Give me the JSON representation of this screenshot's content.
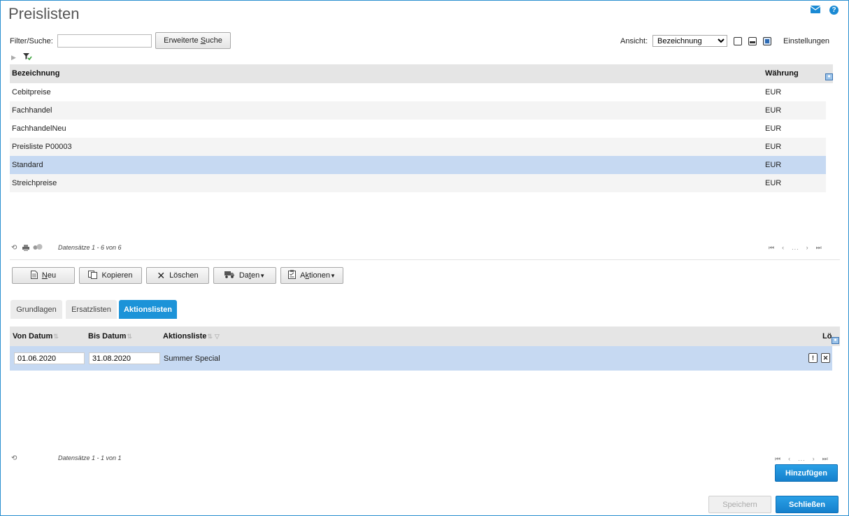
{
  "page": {
    "title": "Preislisten"
  },
  "filter": {
    "label": "Filter/Suche:",
    "value": "",
    "advanced_pre": "Erweiterte ",
    "advanced_u": "S",
    "advanced_post": "uche"
  },
  "view": {
    "label": "Ansicht:",
    "selected": "Bezeichnung",
    "settings": "Einstellungen"
  },
  "grid": {
    "headers": {
      "name": "Bezeichnung",
      "currency": "Währung"
    },
    "rows": [
      {
        "name": "Cebitpreise",
        "currency": "EUR"
      },
      {
        "name": "Fachhandel",
        "currency": "EUR"
      },
      {
        "name": "FachhandelNeu",
        "currency": "EUR"
      },
      {
        "name": "Preisliste P00003",
        "currency": "EUR"
      },
      {
        "name": "Standard",
        "currency": "EUR"
      },
      {
        "name": "Streichpreise",
        "currency": "EUR"
      }
    ],
    "records": "Datensätze 1 - 6 von 6",
    "pager_dots": "..."
  },
  "toolbar": {
    "new_u": "N",
    "new_post": "eu",
    "copy": "Kopieren",
    "delete": "Löschen",
    "data_pre": "Da",
    "data_u": "t",
    "data_post": "en",
    "actions_pre": "A",
    "actions_u": "k",
    "actions_post": "tionen"
  },
  "tabs": [
    "Grundlagen",
    "Ersatzlisten",
    "Aktionslisten"
  ],
  "subgrid": {
    "headers": {
      "from": "Von Datum",
      "to": "Bis Datum",
      "list": "Aktionsliste",
      "del": "Lö"
    },
    "rows": [
      {
        "from": "01.06.2020",
        "to": "31.08.2020",
        "list": "Summer Special"
      }
    ],
    "records": "Datensätze 1 - 1 von 1",
    "pager_dots": "...",
    "add": "Hinzufügen"
  },
  "footer": {
    "save": "Speichern",
    "close": "Schließen"
  },
  "colors": {
    "accent": "#1c93d8",
    "selected_row": "#c6d9f2",
    "header_bg": "#e5e5e5"
  },
  "icons": [
    "mail-icon",
    "help-icon",
    "expand-arrow-icon",
    "filter-icon",
    "column-chooser-icon",
    "refresh-icon",
    "print-icon",
    "group-icon",
    "first-page-icon",
    "prev-page-icon",
    "next-page-icon",
    "last-page-icon",
    "document-icon",
    "copy-icon",
    "delete-icon",
    "truck-icon",
    "clipboard-icon",
    "sort-icon",
    "warning-icon",
    "remove-icon"
  ]
}
